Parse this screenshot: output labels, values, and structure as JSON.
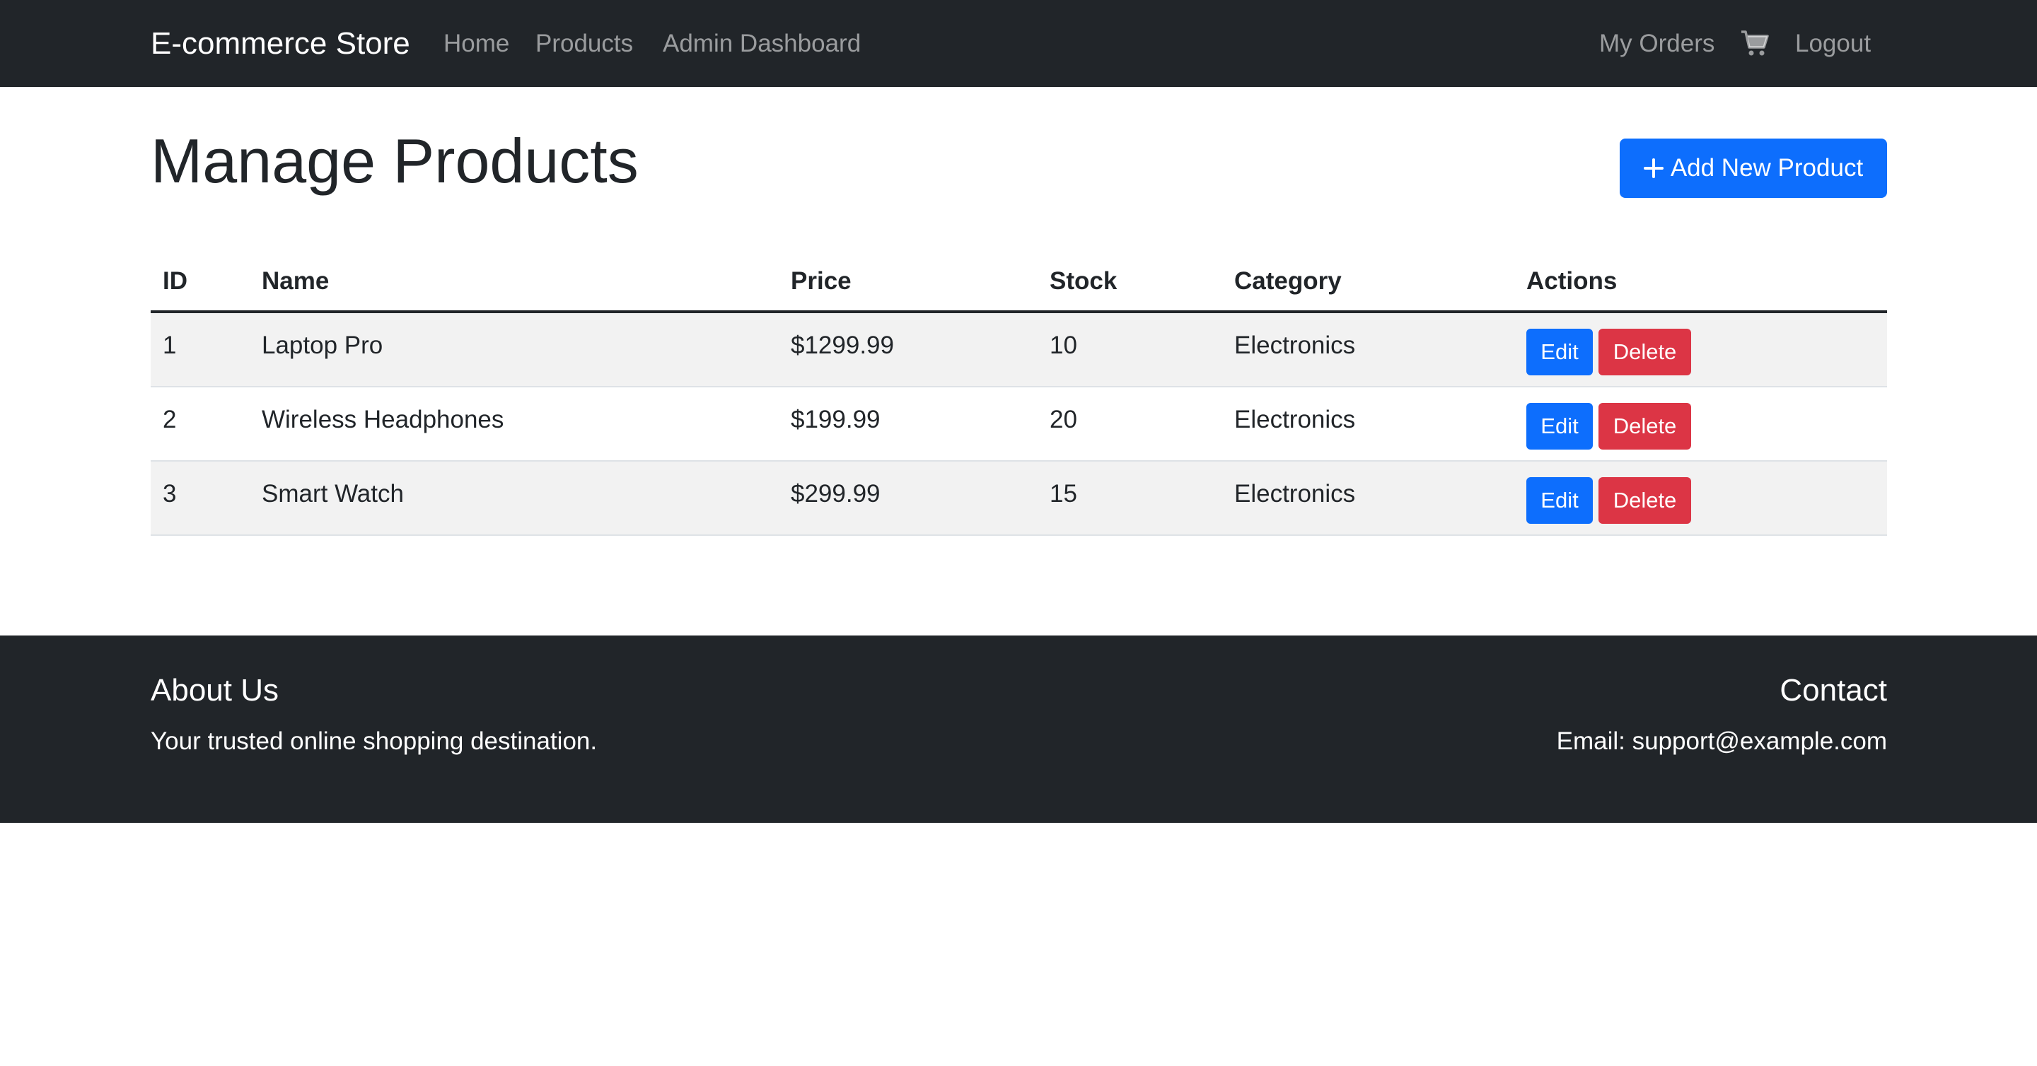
{
  "navbar": {
    "brand": "E-commerce Store",
    "links": [
      "Home",
      "Products",
      "Admin Dashboard"
    ],
    "right_links": [
      "My Orders",
      "Logout"
    ],
    "cart_icon": "cart-icon"
  },
  "main": {
    "title": "Manage Products",
    "add_button": "Add New Product",
    "table": {
      "headers": [
        "ID",
        "Name",
        "Price",
        "Stock",
        "Category",
        "Actions"
      ],
      "rows": [
        {
          "id": "1",
          "name": "Laptop Pro",
          "price": "$1299.99",
          "stock": "10",
          "category": "Electronics"
        },
        {
          "id": "2",
          "name": "Wireless Headphones",
          "price": "$199.99",
          "stock": "20",
          "category": "Electronics"
        },
        {
          "id": "3",
          "name": "Smart Watch",
          "price": "$299.99",
          "stock": "15",
          "category": "Electronics"
        }
      ],
      "edit_label": "Edit",
      "delete_label": "Delete"
    }
  },
  "footer": {
    "about_title": "About Us",
    "about_text": "Your trusted online shopping destination.",
    "contact_title": "Contact",
    "contact_text": "Email: support@example.com"
  },
  "colors": {
    "navbar_bg": "#212529",
    "primary": "#0d6efd",
    "danger": "#dc3545",
    "stripe": "#f2f2f2"
  }
}
